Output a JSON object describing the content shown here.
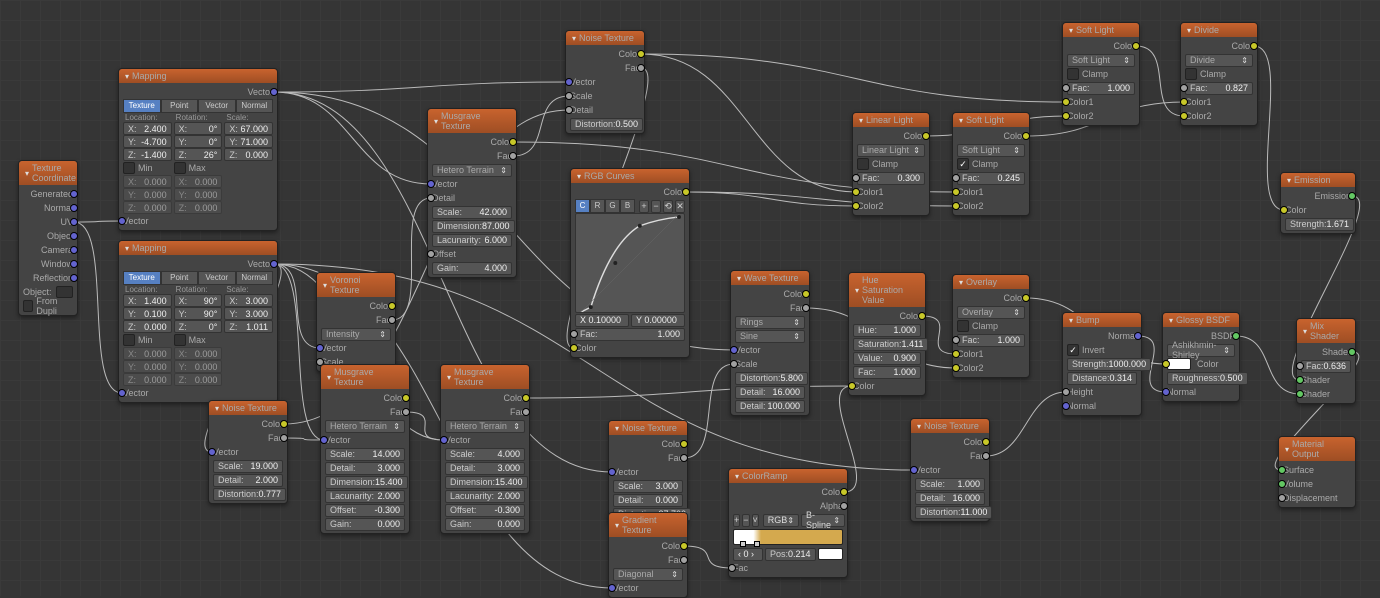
{
  "nodes": {
    "texcoord": {
      "title": "Texture Coordinate",
      "outs": [
        "Generated",
        "Normal",
        "UV",
        "Object",
        "Camera",
        "Window",
        "Reflection"
      ],
      "obj": "Object:",
      "dupli": "From Dupli"
    },
    "map1": {
      "title": "Mapping",
      "out": "Vector",
      "tabs": [
        "Texture",
        "Point",
        "Vector",
        "Normal"
      ],
      "loc": [
        "Location:",
        "X:",
        "2.400",
        "Y:",
        "-4.700",
        "Z:",
        "-1.400"
      ],
      "rot": [
        "Rotation:",
        "X:",
        "0°",
        "Y:",
        "0°",
        "Z:",
        "26°"
      ],
      "scl": [
        "Scale:",
        "X:",
        "67.000",
        "Y:",
        "71.000",
        "Z:",
        "0.000"
      ],
      "min": "Min",
      "max": "Max",
      "v": [
        "X:",
        "0.000",
        "Y:",
        "0.000",
        "Z:",
        "0.000"
      ],
      "vin": "Vector"
    },
    "map2": {
      "title": "Mapping",
      "out": "Vector",
      "tabs": [
        "Texture",
        "Point",
        "Vector",
        "Normal"
      ],
      "loc": [
        "Location:",
        "X:",
        "1.400",
        "Y:",
        "0.100",
        "Z:",
        "0.000"
      ],
      "rot": [
        "Rotation:",
        "X:",
        "90°",
        "Y:",
        "90°",
        "Z:",
        "0°"
      ],
      "scl": [
        "Scale:",
        "X:",
        "3.000",
        "Y:",
        "3.000",
        "Z:",
        "1.011"
      ],
      "min": "Min",
      "max": "Max",
      "v": [
        "X:",
        "0.000",
        "Y:",
        "0.000",
        "Z:",
        "0.000"
      ],
      "vin": "Vector"
    },
    "noise1": {
      "title": "Noise Texture",
      "outs": [
        "Color",
        "Fac"
      ],
      "vin": "Vector",
      "p": [
        [
          "Scale:",
          "19.000"
        ],
        [
          "Detail:",
          "2.000"
        ],
        [
          "Distortion:",
          "0.777"
        ]
      ]
    },
    "noise2": {
      "title": "Noise Texture",
      "outs": [
        "Color",
        "Fac"
      ],
      "ins": [
        "Vector",
        "Scale",
        "Detail"
      ],
      "dist": [
        "Distortion:",
        "0.500"
      ]
    },
    "noise3": {
      "title": "Noise Texture",
      "outs": [
        "Color",
        "Fac"
      ],
      "vin": "Vector",
      "p": [
        [
          "Scale:",
          "3.000"
        ],
        [
          "Detail:",
          "0.000"
        ],
        [
          "Distortion:",
          "37.700"
        ]
      ]
    },
    "noise4": {
      "title": "Noise Texture",
      "outs": [
        "Color",
        "Fac"
      ],
      "vin": "Vector",
      "p": [
        [
          "Scale:",
          "1.000"
        ],
        [
          "Detail:",
          "16.000"
        ],
        [
          "Distortion:",
          "11.000"
        ]
      ]
    },
    "voronoi": {
      "title": "Voronoi Texture",
      "outs": [
        "Color",
        "Fac"
      ],
      "drop": "Intensity",
      "ins": [
        "Vector",
        "Scale"
      ]
    },
    "musg1": {
      "title": "Musgrave Texture",
      "outs": [
        "Color",
        "Fac"
      ],
      "drop": "Hetero Terrain",
      "vals": [
        [
          "Scale:",
          "14.000"
        ],
        [
          "Detail:",
          "3.000"
        ],
        [
          "Dimension:",
          "15.400"
        ],
        [
          "Lacunarity:",
          "2.000"
        ],
        [
          "Offset:",
          "-0.300"
        ],
        [
          "Gain:",
          "0.000"
        ]
      ],
      "vin": "Vector"
    },
    "musg2": {
      "title": "Musgrave Texture",
      "outs": [
        "Color",
        "Fac"
      ],
      "drop": "Hetero Terrain",
      "vals": [
        [
          "Scale:",
          "4.000"
        ],
        [
          "Detail:",
          "3.000"
        ],
        [
          "Dimension:",
          "15.400"
        ],
        [
          "Lacunarity:",
          "2.000"
        ],
        [
          "Offset:",
          "-0.300"
        ],
        [
          "Gain:",
          "0.000"
        ]
      ],
      "vin": "Vector"
    },
    "musg3": {
      "title": "Musgrave Texture",
      "outs": [
        "Color",
        "Fac"
      ],
      "drop": "Hetero Terrain",
      "vin": "Vector",
      "din": "Detail",
      "vals": [
        [
          "Scale:",
          "42.000"
        ],
        [
          "Dimension:",
          "87.000"
        ],
        [
          "Lacunarity:",
          "6.000"
        ],
        [
          "Gain:",
          "4.000"
        ]
      ],
      "off": "Offset"
    },
    "wave": {
      "title": "Wave Texture",
      "outs": [
        "Color",
        "Fac"
      ],
      "d1": "Rings",
      "d2": "Sine",
      "ins": [
        "Vector",
        "Scale"
      ],
      "p": [
        [
          "Distortion:",
          "5.800"
        ],
        [
          "Detail:",
          "16.000"
        ],
        [
          "Detail:",
          "100.000"
        ]
      ]
    },
    "grad": {
      "title": "Gradient Texture",
      "outs": [
        "Color",
        "Fac"
      ],
      "drop": "Diagonal",
      "vin": "Vector"
    },
    "ramp": {
      "title": "ColorRamp",
      "outs": [
        "Color",
        "Alpha"
      ],
      "d1": "RGB",
      "d2": "B-Spline",
      "pos": [
        "Pos:",
        "0.214"
      ],
      "idx": "0",
      "fin": "Fac"
    },
    "curves": {
      "title": "RGB Curves",
      "out": "Color",
      "tabs": [
        "C",
        "R",
        "G",
        "B"
      ],
      "x": [
        "X 0.10000"
      ],
      "y": [
        "Y 0.00000"
      ],
      "fac": [
        "Fac:",
        "1.000"
      ],
      "cin": "Color"
    },
    "linlight": {
      "title": "Linear Light",
      "out": "Color",
      "drop": "Linear Light",
      "clamp": "Clamp",
      "fac": [
        "Fac:",
        "0.300"
      ],
      "ins": [
        "Color1",
        "Color2"
      ]
    },
    "softlight1": {
      "title": "Soft Light",
      "out": "Color",
      "drop": "Soft Light",
      "clamp": "Clamp",
      "fac": [
        "Fac:",
        "1.000"
      ],
      "ins": [
        "Color1",
        "Color2"
      ]
    },
    "softlight2": {
      "title": "Soft Light",
      "out": "Color",
      "drop": "Soft Light",
      "clamp": "Clamp",
      "fac": [
        "Fac:",
        "0.245"
      ],
      "ins": [
        "Color1",
        "Color2"
      ]
    },
    "overlay": {
      "title": "Overlay",
      "out": "Color",
      "drop": "Overlay",
      "clamp": "Clamp",
      "fac": [
        "Fac:",
        "1.000"
      ],
      "ins": [
        "Color1",
        "Color2"
      ]
    },
    "divide": {
      "title": "Divide",
      "out": "Color",
      "drop": "Divide",
      "clamp": "Clamp",
      "fac": [
        "Fac:",
        "0.827"
      ],
      "ins": [
        "Color1",
        "Color2"
      ]
    },
    "hsv": {
      "title": "Hue Saturation Value",
      "out": "Color",
      "p": [
        [
          "Hue:",
          "1.000"
        ],
        [
          "Saturation:",
          "1.411"
        ],
        [
          "Value:",
          "0.900"
        ],
        [
          "Fac:",
          "1.000"
        ]
      ],
      "cin": "Color"
    },
    "bump": {
      "title": "Bump",
      "out": "Normal",
      "inv": "Invert",
      "p": [
        [
          "Strength:",
          "1000.000"
        ],
        [
          "Distance:",
          "0.314"
        ]
      ],
      "ins": [
        "Height",
        "Normal"
      ]
    },
    "glossy": {
      "title": "Glossy BSDF",
      "out": "BSDF",
      "drop": "Ashikhmin-Shirley",
      "col": "Color",
      "rough": [
        "Roughness:",
        "0.500"
      ],
      "nin": "Normal"
    },
    "emission": {
      "title": "Emission",
      "out": "Emission",
      "cin": "Color",
      "str": [
        "Strength:",
        "1.671"
      ]
    },
    "mix": {
      "title": "Mix Shader",
      "out": "Shader",
      "fac": [
        "Fac:",
        "0.636"
      ],
      "ins": [
        "Shader",
        "Shader"
      ]
    },
    "output": {
      "title": "Material Output",
      "ins": [
        "Surface",
        "Volume",
        "Displacement"
      ]
    }
  },
  "wires": [
    [
      "texcoord.UV",
      "map1.vin"
    ],
    [
      "texcoord.UV",
      "map2.vin"
    ],
    [
      "map1.out",
      "musg3.vin"
    ],
    [
      "map1.out",
      "noise2.Vector"
    ],
    [
      "map1.out",
      "wave.Vector"
    ],
    [
      "map1.out",
      "noise3.vin"
    ],
    [
      "map2.out",
      "noise1.vin"
    ],
    [
      "map2.out",
      "voronoi.Vector"
    ],
    [
      "map2.out",
      "musg1.vin"
    ],
    [
      "map2.out",
      "musg2.vin"
    ],
    [
      "map2.out",
      "grad.vin"
    ],
    [
      "map2.out",
      "noise4.vin"
    ],
    [
      "voronoi.Fac",
      "musg3.din"
    ],
    [
      "noise1.Fac",
      "musg1.vin"
    ],
    [
      "noise1.Color",
      "noise2.Detail"
    ],
    [
      "noise2.Fac",
      "curves.cin"
    ],
    [
      "noise2.Color",
      "linlight.Color1"
    ],
    [
      "noise2.Color",
      "softlight1.Color1"
    ],
    [
      "musg1.Fac",
      "musg2.vin"
    ],
    [
      "musg2.Color",
      "hsv.cin"
    ],
    [
      "musg3.Fac",
      "noise2.Scale"
    ],
    [
      "musg3.Color",
      "softlight2.Color1"
    ],
    [
      "curves.out",
      "softlight2.Color2"
    ],
    [
      "curves.out",
      "linlight.Color2"
    ],
    [
      "wave.Fac",
      "overlay.Color2"
    ],
    [
      "noise3.Fac",
      "wave.Scale"
    ],
    [
      "grad.Color",
      "ramp.fin"
    ],
    [
      "ramp.Color",
      "hsv.cin"
    ],
    [
      "hsv.out",
      "overlay.Color1"
    ],
    [
      "noise4.Fac",
      "bump.Height"
    ],
    [
      "linlight.out",
      "softlight1.Color2"
    ],
    [
      "softlight2.out",
      "divide.Color1"
    ],
    [
      "softlight1.out",
      "divide.Color2"
    ],
    [
      "overlay.out",
      "glossy.col"
    ],
    [
      "divide.out",
      "emission.cin"
    ],
    [
      "bump.out",
      "glossy.nin"
    ],
    [
      "glossy.out",
      "mix.Shader2"
    ],
    [
      "emission.out",
      "mix.Shader1"
    ],
    [
      "mix.out",
      "output.Surface"
    ]
  ]
}
